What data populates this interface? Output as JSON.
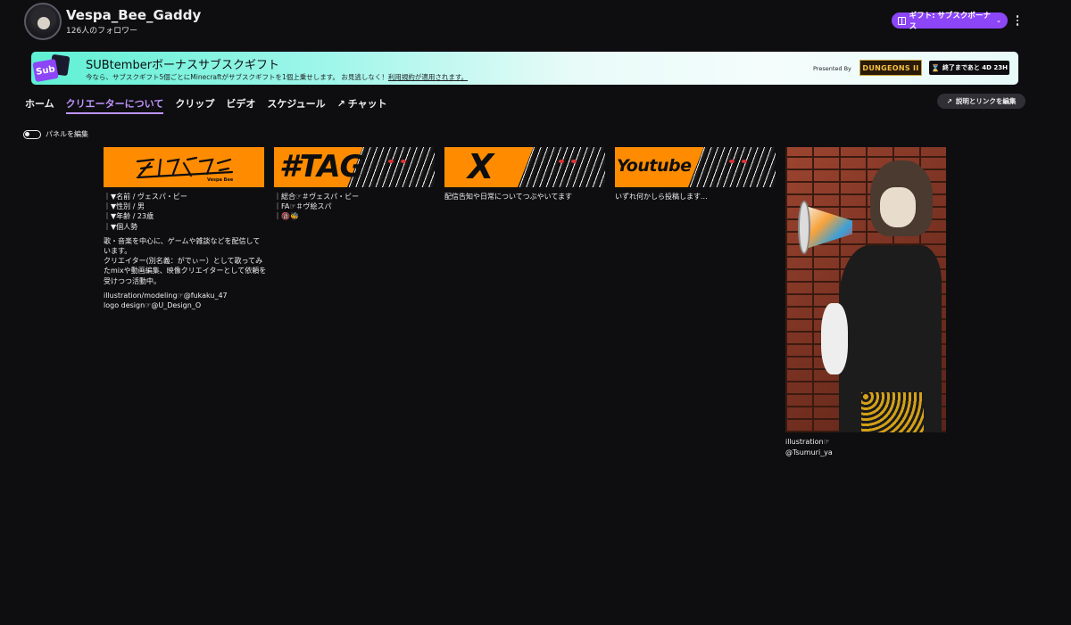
{
  "channel": {
    "name": "Vespa_Bee_Gaddy",
    "followers": "126人のフォロワー"
  },
  "header": {
    "gift_button_label": "ギフト: サブスクボーナス",
    "gift_chevron": "⌄",
    "more_icon": "kebab-icon"
  },
  "banner": {
    "logo_text": "Sub",
    "title": "SUBtemberボーナスサブスクギフト",
    "description": "今なら、サブスクギフト5個ごとにMinecraftがサブスクギフトを1個上乗せします。 お見逃しなく！",
    "link_text": "利用規約が適用されます。",
    "presented_by": "Presented By",
    "sponsor_logo": "DUNGEONS II",
    "countdown": "終了まであと 4D 23H"
  },
  "nav": {
    "tabs": [
      {
        "label": "ホーム",
        "active": false
      },
      {
        "label": "クリエーターについて",
        "active": true
      },
      {
        "label": "クリップ",
        "active": false
      },
      {
        "label": "ビデオ",
        "active": false
      },
      {
        "label": "スケジュール",
        "active": false
      },
      {
        "label": "チャット",
        "active": false
      }
    ],
    "edit_links_label": "説明とリンクを編集"
  },
  "panel_edit_toggle": {
    "label": "パネルを編集",
    "checked": false
  },
  "panels": [
    {
      "image_logo_sub": "Vespa Bee",
      "lines": [
        "｜▼名前 / ヴェスパ・ビー",
        "｜▼性別 / 男",
        "｜▼年齢 / 23歳",
        "｜▼個人勢"
      ],
      "body": [
        "歌・音楽を中心に、ゲームや雑談などを配信して",
        "います。",
        "クリエイター(別名義：がでぃー）として歌ってみ",
        "たmixや動画編集、映像クリエイターとして依頼を",
        "受けつつ活動中。"
      ],
      "credits": [
        "illustration/modeling☞@fukaku_47",
        "logo design☞@U_Design_O"
      ]
    },
    {
      "image_text": "#TAG",
      "lines": [
        "｜総合☞＃ヴェスパ・ビー",
        "｜FA☞＃ヴ絵スパ",
        "｜🔞🐝"
      ]
    },
    {
      "image_text": "X",
      "lines": [
        "配信告知や日常についてつぶやいてます"
      ]
    },
    {
      "image_text": "Youtube",
      "lines": [
        "いずれ何かしら投稿します..."
      ]
    }
  ],
  "tall_panel": {
    "caption": [
      "illustration☞",
      "@Tsumuri_ya"
    ]
  },
  "colors": {
    "background": "#0e0e10",
    "accent": "#bf94ff",
    "gift_purple": "#8c45f7",
    "panel_orange": "#ff8c00"
  }
}
